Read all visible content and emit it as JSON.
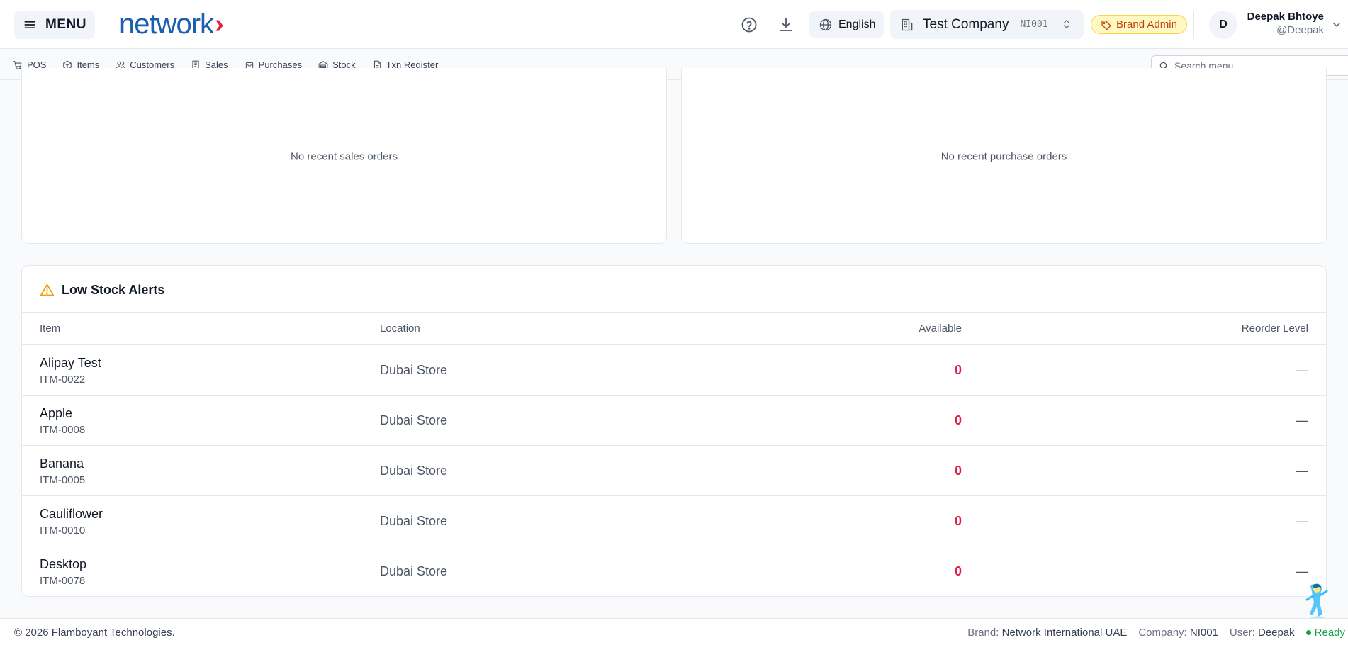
{
  "header": {
    "menu_label": "MENU",
    "logo_text": "network",
    "logo_chevron": "›",
    "language": "English",
    "company_name": "Test Company",
    "company_code": "NI001",
    "role": "Brand Admin",
    "user_initial": "D",
    "user_name": "Deepak Bhtoye",
    "user_handle": "@Deepak",
    "colors": {
      "brand_blue": "#1d5fae",
      "brand_red": "#e11d48",
      "badge_text": "#c2410c"
    },
    "icons": [
      "menu-icon",
      "help-icon",
      "download-icon",
      "globe-icon",
      "building-icon",
      "updown-icon",
      "tag-icon",
      "chevron-down-icon"
    ]
  },
  "nav": {
    "items": [
      {
        "label": "POS",
        "icon": "cart-icon"
      },
      {
        "label": "Items",
        "icon": "box-icon"
      },
      {
        "label": "Customers",
        "icon": "users-icon"
      },
      {
        "label": "Sales",
        "icon": "receipt-icon"
      },
      {
        "label": "Purchases",
        "icon": "bag-icon"
      },
      {
        "label": "Stock",
        "icon": "warehouse-icon"
      },
      {
        "label": "Txn Register",
        "icon": "file-icon"
      }
    ],
    "search_placeholder": "Search menu..."
  },
  "sales_card": {
    "empty_text": "No recent sales orders"
  },
  "purchase_card": {
    "empty_text": "No recent purchase orders"
  },
  "low_stock": {
    "title": "Low Stock Alerts",
    "columns": {
      "item": "Item",
      "location": "Location",
      "available": "Available",
      "reorder": "Reorder Level"
    },
    "rows": [
      {
        "name": "Alipay Test",
        "code": "ITM-0022",
        "location": "Dubai Store",
        "available": "0",
        "reorder": "—"
      },
      {
        "name": "Apple",
        "code": "ITM-0008",
        "location": "Dubai Store",
        "available": "0",
        "reorder": "—"
      },
      {
        "name": "Banana",
        "code": "ITM-0005",
        "location": "Dubai Store",
        "available": "0",
        "reorder": "—"
      },
      {
        "name": "Cauliflower",
        "code": "ITM-0010",
        "location": "Dubai Store",
        "available": "0",
        "reorder": "—"
      },
      {
        "name": "Desktop",
        "code": "ITM-0078",
        "location": "Dubai Store",
        "available": "0",
        "reorder": "—"
      }
    ]
  },
  "footer": {
    "copyright": "© 2026 Flamboyant Technologies.",
    "brand_label": "Brand:",
    "brand_value": "Network International UAE",
    "company_label": "Company:",
    "company_value": "NI001",
    "user_label": "User:",
    "user_value": "Deepak",
    "status": "Ready"
  }
}
